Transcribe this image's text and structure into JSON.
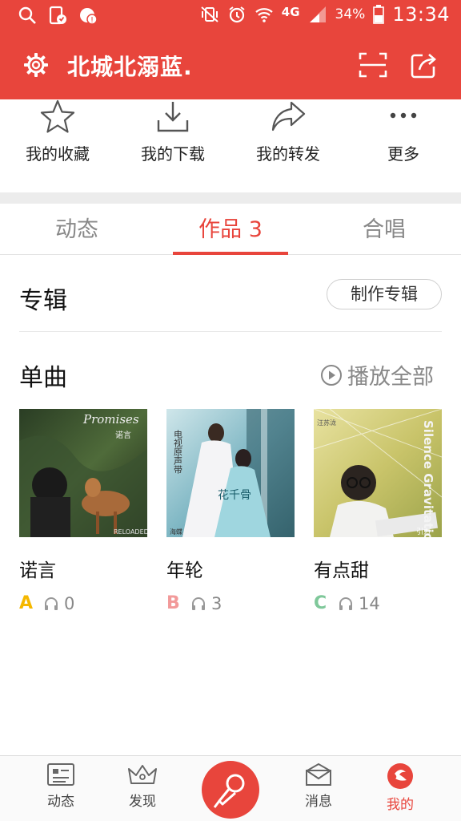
{
  "status_bar": {
    "icons_left": [
      "search-icon",
      "sim-call-icon",
      "notification-badge-icon"
    ],
    "icons_right": [
      "vibrate-off-icon",
      "alarm-icon",
      "wifi-icon",
      "network-4g-icon",
      "signal-icon"
    ],
    "network": "4G",
    "battery": "34%",
    "time": "13:34"
  },
  "header": {
    "title": "北城北溺蓝.",
    "icons": [
      "gear-icon",
      "scan-icon",
      "share-icon"
    ],
    "color": "#e8453c"
  },
  "quick_actions": [
    {
      "label": "我的收藏",
      "icon": "star-icon"
    },
    {
      "label": "我的下载",
      "icon": "download-icon"
    },
    {
      "label": "我的转发",
      "icon": "forward-icon"
    },
    {
      "label": "更多",
      "icon": "more-icon"
    }
  ],
  "tabs": [
    {
      "label": "动态",
      "active": false
    },
    {
      "label": "作品 3",
      "active": true
    },
    {
      "label": "合唱",
      "active": false
    }
  ],
  "album_section": {
    "title": "专辑",
    "button": "制作专辑"
  },
  "singles_section": {
    "title": "单曲",
    "play_all": "播放全部"
  },
  "songs": [
    {
      "name": "诺言",
      "grade": "A",
      "grade_color": "#f5b800",
      "plays": "0",
      "cover_text": "Promises",
      "cover_sub": "诺言",
      "cover_badge": "RELOADED"
    },
    {
      "name": "年轮",
      "grade": "B",
      "grade_color": "#f29a9a",
      "plays": "3",
      "cover_text": "电视原声带",
      "cover_sub": "花千骨",
      "cover_badge": "海蝶"
    },
    {
      "name": "有点甜",
      "grade": "C",
      "grade_color": "#7fc89a",
      "plays": "14",
      "cover_text": "Silence Gravitation",
      "cover_sub": "汪苏泷",
      "cover_badge": "引力"
    }
  ],
  "bottom_nav": [
    {
      "label": "动态",
      "icon": "feed-icon",
      "active": false
    },
    {
      "label": "发现",
      "icon": "crown-icon",
      "active": false
    },
    {
      "label": "",
      "icon": "microphone-icon",
      "active": false
    },
    {
      "label": "消息",
      "icon": "message-icon",
      "active": false
    },
    {
      "label": "我的",
      "icon": "profile-icon",
      "active": true
    }
  ]
}
